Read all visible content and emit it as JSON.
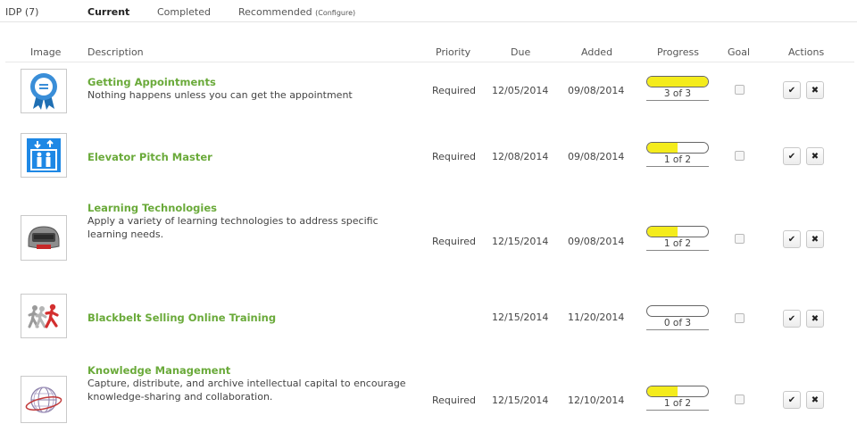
{
  "tabs": {
    "title": "IDP (7)",
    "current": "Current",
    "completed": "Completed",
    "recommended": "Recommended",
    "configure": "(Configure)"
  },
  "columns": {
    "image": "Image",
    "description": "Description",
    "priority": "Priority",
    "due": "Due",
    "added": "Added",
    "progress": "Progress",
    "goal": "Goal",
    "actions": "Actions"
  },
  "items": [
    {
      "name": "Getting Appointments",
      "description": "Nothing happens unless you can get the appointment",
      "priority": "Required",
      "due": "12/05/2014",
      "added": "09/08/2014",
      "progress_label": "3 of 3",
      "progress_fraction": 1.0,
      "icon": "ribbon-badge-icon"
    },
    {
      "name": "Elevator Pitch Master",
      "description": "",
      "priority": "Required",
      "due": "12/08/2014",
      "added": "09/08/2014",
      "progress_label": "1 of 2",
      "progress_fraction": 0.5,
      "icon": "elevator-icon"
    },
    {
      "name": "Learning Technologies",
      "description": "Apply a variety of learning technologies to address specific learning needs.",
      "priority": "Required",
      "due": "12/15/2014",
      "added": "09/08/2014",
      "progress_label": "1 of 2",
      "progress_fraction": 0.5,
      "icon": "hi-tech-icon"
    },
    {
      "name": "Blackbelt Selling Online Training",
      "description": "",
      "priority": "",
      "due": "12/15/2014",
      "added": "11/20/2014",
      "progress_label": "0 of 3",
      "progress_fraction": 0.0,
      "icon": "runners-icon"
    },
    {
      "name": "Knowledge Management",
      "description": "Capture, distribute, and archive intellectual capital to encourage knowledge-sharing and collaboration.",
      "priority": "Required",
      "due": "12/15/2014",
      "added": "12/10/2014",
      "progress_label": "1 of 2",
      "progress_fraction": 0.5,
      "icon": "globe-icon"
    }
  ],
  "colors": {
    "link_green": "#6aaa3a",
    "progress_yellow": "#f4ec1c"
  }
}
